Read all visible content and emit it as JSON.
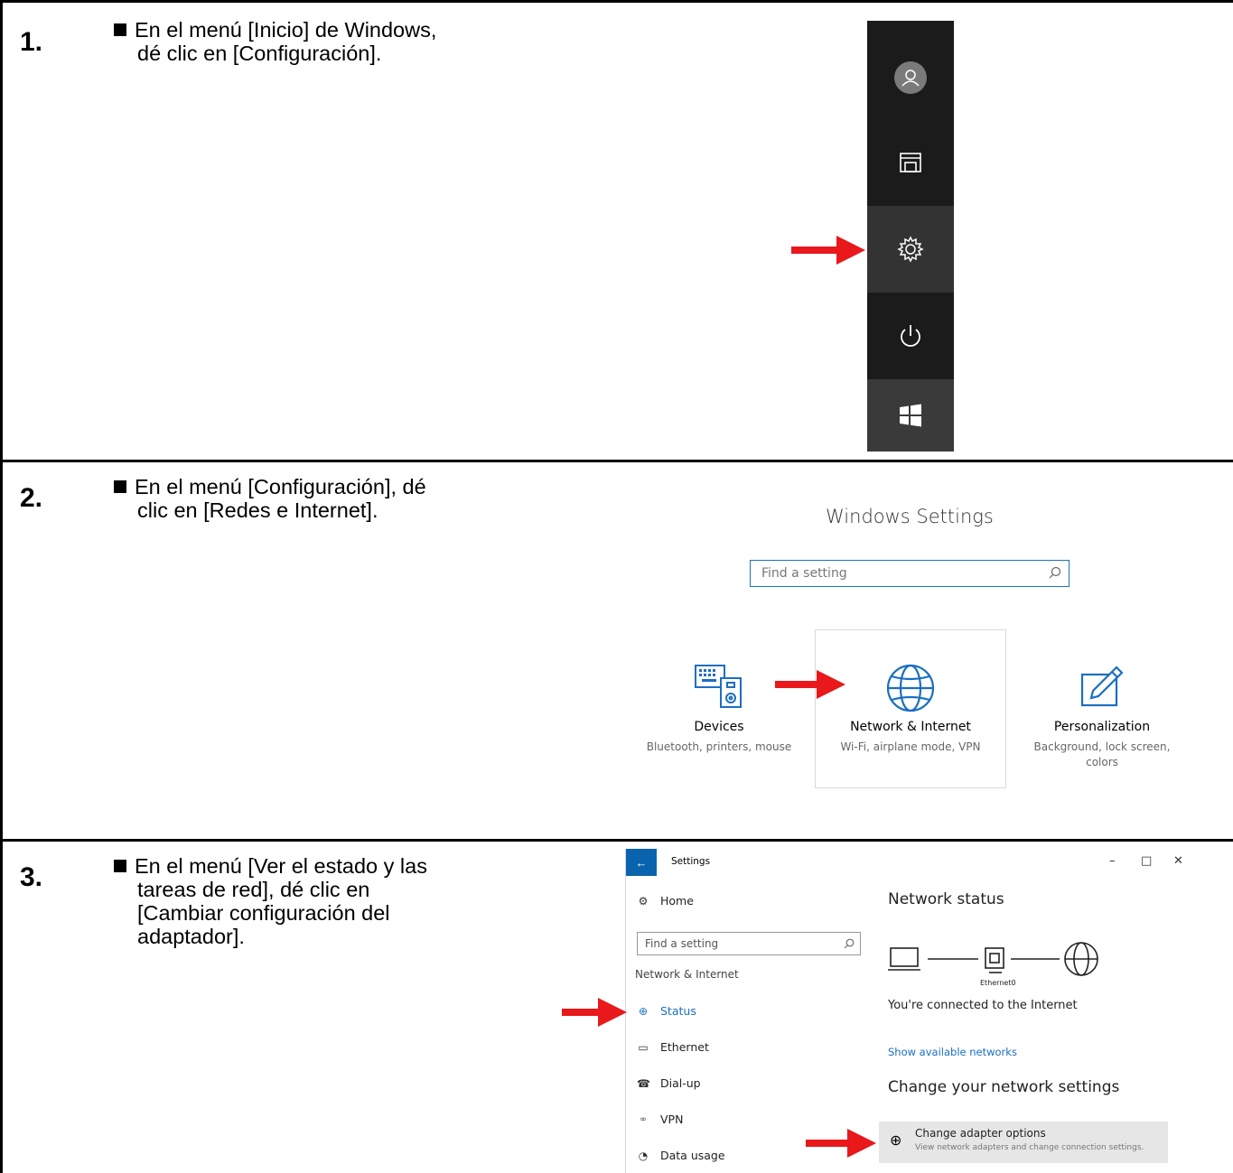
{
  "steps": [
    {
      "number": "1.",
      "lines": [
        "En el menú [Inicio] de Windows,",
        "dé clic en [Configuración]."
      ]
    },
    {
      "number": "2.",
      "lines": [
        "En el menú [Configuración], dé",
        "clic en [Redes e Internet]."
      ]
    },
    {
      "number": "3.",
      "lines": [
        "En el menú [Ver el estado y las",
        "tareas de red], dé clic en",
        "[Cambiar configuración del",
        "adaptador]."
      ]
    }
  ],
  "start_menu": {
    "icons": [
      "user-icon",
      "file-explorer-icon",
      "settings-gear-icon",
      "power-icon",
      "windows-logo-icon"
    ]
  },
  "windows_settings": {
    "title": "Windows Settings",
    "search_placeholder": "Find a setting",
    "tiles": [
      {
        "icon": "devices-icon",
        "name": "Devices",
        "sub": [
          "Bluetooth, printers, mouse"
        ]
      },
      {
        "icon": "globe-icon",
        "name": "Network & Internet",
        "sub": [
          "Wi-Fi, airplane mode, VPN"
        ]
      },
      {
        "icon": "personalization-icon",
        "name": "Personalization",
        "sub": [
          "Background, lock screen,",
          "colors"
        ]
      }
    ]
  },
  "settings_window": {
    "title": "Settings",
    "back_glyph": "←",
    "controls": {
      "minimize": "–",
      "maximize": "□",
      "close": "✕"
    },
    "home": "Home",
    "search_placeholder": "Find a setting",
    "section": "Network & Internet",
    "nav": [
      {
        "icon": "globe-icon",
        "label": "Status",
        "selected": true
      },
      {
        "icon": "ethernet-icon",
        "label": "Ethernet"
      },
      {
        "icon": "dialup-icon",
        "label": "Dial-up"
      },
      {
        "icon": "vpn-icon",
        "label": "VPN"
      },
      {
        "icon": "data-usage-icon",
        "label": "Data usage"
      }
    ],
    "network_status_heading": "Network status",
    "ethernet_label": "Ethernet0",
    "connected_text": "You're connected to the Internet",
    "show_networks_link": "Show available networks",
    "change_heading": "Change your network settings",
    "adapter_title": "Change adapter options",
    "adapter_sub": "View network adapters and change connection settings.",
    "accent_color": "#1a6fc2"
  },
  "arrow_color": "#e8181b"
}
